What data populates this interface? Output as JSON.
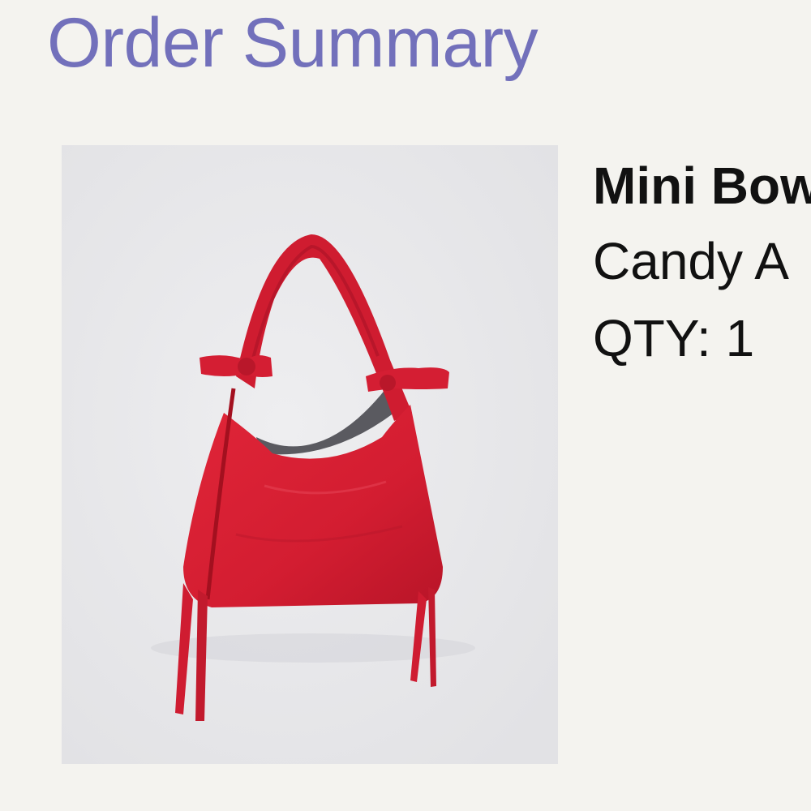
{
  "colors": {
    "title": "#7270bb",
    "background": "#f4f3ef",
    "text": "#111111",
    "bag": "#d81f34",
    "photo_background": "#e8e8ea"
  },
  "header": {
    "title": "Order Summary"
  },
  "order_item": {
    "image_icon": "red-bow-handbag-image",
    "name": "Mini Bow",
    "variant": "Candy A",
    "quantity": "QTY: 1"
  }
}
